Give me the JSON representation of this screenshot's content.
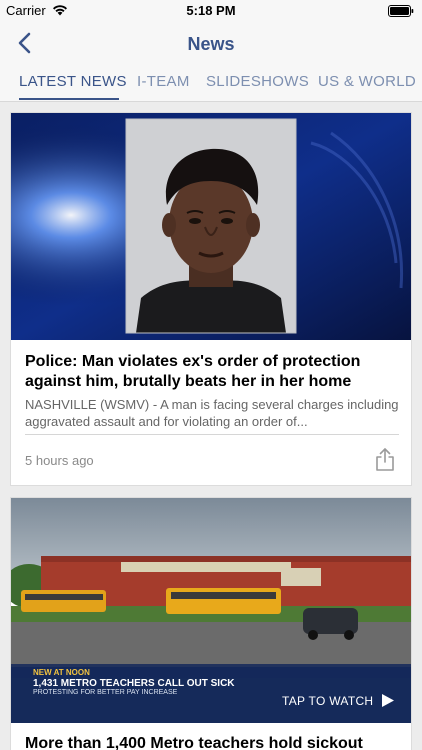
{
  "status_bar": {
    "carrier": "Carrier",
    "time": "5:18 PM"
  },
  "nav": {
    "title": "News",
    "back_icon": "chevron-left-icon"
  },
  "tabs": [
    {
      "label": "LATEST NEWS",
      "active": true
    },
    {
      "label": "I-TEAM",
      "active": false
    },
    {
      "label": "SLIDESHOWS",
      "active": false
    },
    {
      "label": "US & WORLD",
      "active": false
    }
  ],
  "articles": [
    {
      "headline": "Police: Man violates ex's order of protection against him, brutally beats her in her home",
      "summary": "NASHVILLE (WSMV) - A man is facing several charges including aggravated assault and for violating an order of...",
      "timestamp": "5 hours ago",
      "share_icon": "share-icon"
    },
    {
      "headline": "More than 1,400 Metro teachers hold sickout",
      "video_cta": "TAP TO WATCH",
      "chyron_kicker": "NEW AT NOON",
      "chyron_main": "1,431 METRO TEACHERS CALL OUT SICK",
      "chyron_sub": "PROTESTING FOR BETTER PAY INCREASE"
    }
  ],
  "colors": {
    "accent": "#3a5489",
    "tab_inactive": "#7d8fb0",
    "background": "#ececec"
  }
}
